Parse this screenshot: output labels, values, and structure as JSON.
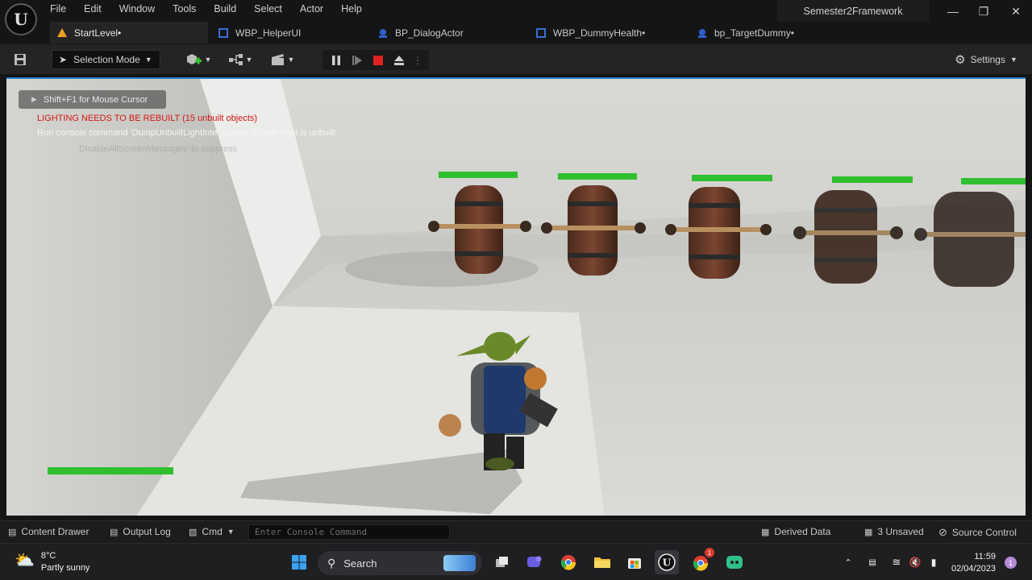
{
  "menubar": {
    "items": [
      "File",
      "Edit",
      "Window",
      "Tools",
      "Build",
      "Select",
      "Actor",
      "Help"
    ],
    "project_name": "Semester2Framework"
  },
  "tabs": [
    {
      "label": "StartLevel•",
      "icon": "level-warning-icon"
    },
    {
      "label": "WBP_HelperUI",
      "icon": "widget-blueprint-icon"
    },
    {
      "label": "BP_DialogActor",
      "icon": "blueprint-icon"
    },
    {
      "label": "WBP_DummyHealth•",
      "icon": "widget-blueprint-icon"
    },
    {
      "label": "bp_TargetDummy•",
      "icon": "blueprint-icon"
    }
  ],
  "toolbar": {
    "selection_mode": "Selection Mode",
    "settings_label": "Settings"
  },
  "viewport": {
    "cursor_hint": "Shift+F1 for Mouse Cursor",
    "lighting_warning": "LIGHTING NEEDS TO BE REBUILT (15 unbuilt objects)",
    "console_hint": "Run console command 'DumpUnbuiltLightInteractions' to see what is unbuilt",
    "suppress_hint": "'DisableAllScreenMessages' to suppress"
  },
  "statusbar": {
    "content_drawer": "Content Drawer",
    "output_log": "Output Log",
    "cmd": "Cmd",
    "console_placeholder": "Enter Console Command",
    "derived_data": "Derived Data",
    "unsaved": "3 Unsaved",
    "source_control": "Source Control"
  },
  "taskbar": {
    "temperature": "8°C",
    "weather": "Partly sunny",
    "search": "Search",
    "time": "11:59",
    "date": "02/04/2023",
    "notification_count": "1",
    "chrome_badge": "1"
  },
  "colors": {
    "accent": "#2a7fd6",
    "health_bar": "#2fbf2f",
    "warning_red": "#d41818"
  }
}
